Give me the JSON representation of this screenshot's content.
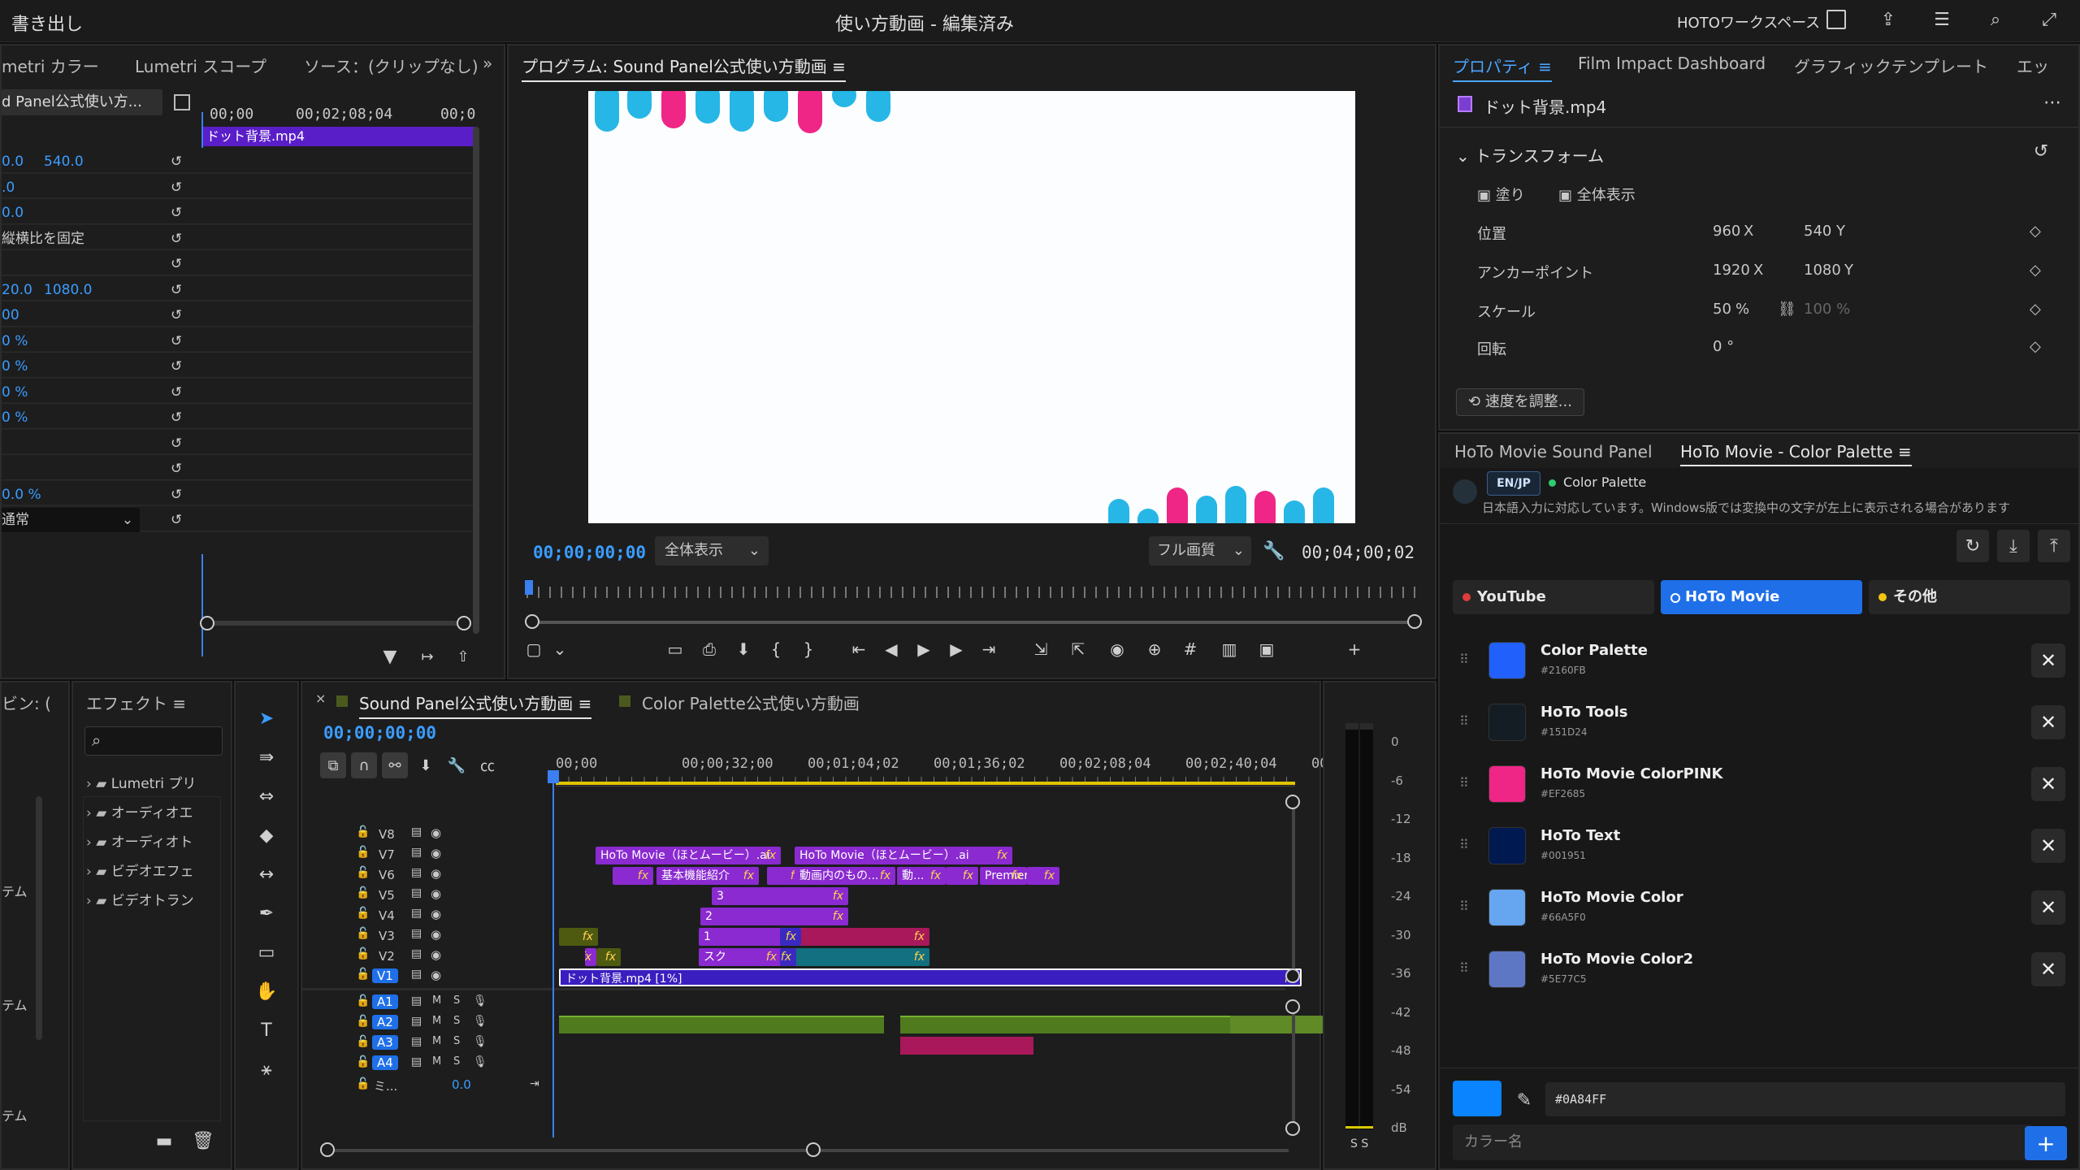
{
  "topbar": {
    "export_label": "書き出し",
    "title": "使い方動画 - 編集済み",
    "workspace": "HOTOワークスペース"
  },
  "source_panel": {
    "tabs": [
      "metri カラー",
      "Lumetri スコープ",
      "ソース：(クリップなし)"
    ],
    "clip_name": "d Panel公式使い方...",
    "tl_time1": "00;00",
    "tl_time2": "00;02;08;04",
    "tl_time3": "00;0",
    "timeline_clip": "ドット背景.mp4",
    "rows": [
      "0.0",
      "540.0",
      ".0",
      "0.0",
      "縦横比を固定",
      "",
      "20.0",
      "1080.0",
      "00",
      "0 %",
      "0 %",
      "0 %",
      "0 %",
      "",
      "",
      "0.0 %",
      "通常"
    ]
  },
  "program": {
    "tab": "プログラム: Sound Panel公式使い方動画",
    "timecode": "00;00;00;00",
    "fit": "全体表示",
    "quality": "フル画質",
    "duration": "00;04;00;02"
  },
  "properties": {
    "tabs": [
      "プロパティ",
      "Film Impact Dashboard",
      "グラフィックテンプレート",
      "エッ"
    ],
    "file": "ドット背景.mp4",
    "section": "トランスフォーム",
    "fill": "塗り",
    "fit": "全体表示",
    "pos_label": "位置",
    "pos_x": "960",
    "pos_y": "540",
    "anchor_label": "アンカーポイント",
    "anchor_x": "1920",
    "anchor_y": "1080",
    "scale_label": "スケール",
    "scale_v": "50",
    "scale_pct": "%",
    "scale_w": "100 %",
    "rot_label": "回転",
    "rot_v": "0 °",
    "x": "X",
    "y": "Y",
    "speed": "速度を調整..."
  },
  "palette": {
    "tabs": [
      "HoTo Movie Sound Panel",
      "HoTo Movie - Color Palette"
    ],
    "lang": "EN/JP",
    "title": "Color Palette",
    "note": "日本語入力に対応しています。Windows版では変換中の文字が左上に表示される場合があります",
    "cats": [
      "YouTube",
      "HoTo Movie",
      "その他"
    ],
    "items": [
      {
        "name": "Color Palette",
        "hex": "#2160FB",
        "color": "#2160fb"
      },
      {
        "name": "HoTo Tools",
        "hex": "#151D24",
        "color": "#151d24"
      },
      {
        "name": "HoTo Movie ColorPINK",
        "hex": "#EF2685",
        "color": "#ef2685"
      },
      {
        "name": "HoTo Text",
        "hex": "#001951",
        "color": "#001951"
      },
      {
        "name": "HoTo Movie Color",
        "hex": "#66A5F0",
        "color": "#66a5f0"
      },
      {
        "name": "HoTo Movie Color2",
        "hex": "#5E77C5",
        "color": "#5e77c5"
      }
    ],
    "hex_input": "#0A84FF",
    "name_placeholder": "カラー名"
  },
  "project": {
    "tab": "ビン: (",
    "rows": [
      "テム",
      "テム",
      "テム"
    ]
  },
  "effects": {
    "tab": "エフェクト",
    "items": [
      "Lumetri プリ",
      "オーディオエ",
      "オーディオト",
      "ビデオエフェ",
      "ビデオトラン"
    ]
  },
  "timeline": {
    "tabs": [
      "Sound Panel公式使い方動画",
      "Color Palette公式使い方動画"
    ],
    "timecode": "00;00;00;00",
    "ruler": [
      "00;00",
      "00;00;32;00",
      "00;01;04;02",
      "00;01;36;02",
      "00;02;08;04",
      "00;02;40;04",
      "00;"
    ],
    "video_tracks": [
      "V8",
      "V7",
      "V6",
      "V5",
      "V4",
      "V3",
      "V2",
      "V1"
    ],
    "audio_tracks": [
      "A1",
      "A2",
      "A3",
      "A4"
    ],
    "mix_label": "ミ...",
    "mix_val": "0.0",
    "clips": {
      "v7a": "HoTo Movie（ほとムービー）.ai",
      "v7b": "HoTo Movie（ほとムービー）.ai",
      "v6a": "基本機能紹介",
      "v6b": "動画内のもの...",
      "v6c": "動...",
      "v6d": "Premiere...",
      "v5": "3",
      "v4": "2",
      "v3": "1",
      "v2": "スクリーンショ...",
      "v1": "ドット背景.mp4 [1%]"
    }
  },
  "meter": {
    "scale": [
      "0",
      "-6",
      "-12",
      "-18",
      "-24",
      "-30",
      "-36",
      "-42",
      "-48",
      "-54",
      "dB"
    ],
    "solo": "S  S"
  }
}
